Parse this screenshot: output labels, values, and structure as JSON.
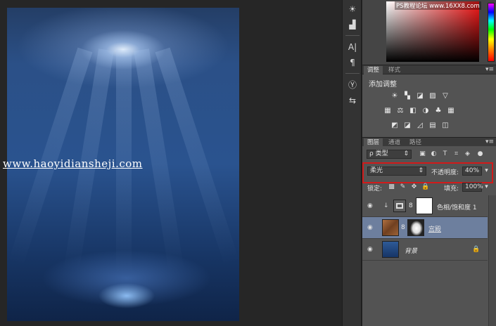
{
  "canvas": {
    "watermark": "www.haoyidiansheji.com"
  },
  "color_panel": {
    "watermark": "PS教程论坛 www.16XX8.com"
  },
  "tool_column": {
    "icons": [
      "brightness-icon",
      "histogram-icon",
      "character-icon",
      "paragraph-icon",
      "brush-preset-icon",
      "tool-preset-icon"
    ],
    "glyphs": [
      "☀",
      "▟",
      "A|",
      "¶",
      "Ⓨ",
      "⇆"
    ]
  },
  "adjust_panel": {
    "tabs": [
      "调整",
      "样式"
    ],
    "title": "添加调整",
    "menu": "▾≡",
    "row1": [
      "☀",
      "▚",
      "◪",
      "▨",
      "▽"
    ],
    "row2": [
      "▦",
      "⚖",
      "◧",
      "◑",
      "♣",
      "▦"
    ],
    "row3": [
      "◩",
      "◪",
      "◿",
      "▤",
      "◫"
    ]
  },
  "layers_panel": {
    "tabs": [
      "图层",
      "通道",
      "路径"
    ],
    "menu": "▾≡",
    "filter_label": "ρ 类型",
    "filter_arrow": "⇕",
    "filter_icons": [
      "▣",
      "◐",
      "T",
      "⌗",
      "◈",
      "●"
    ],
    "blend_mode": "柔光",
    "blend_arrow": "⇕",
    "opacity_label": "不透明度:",
    "opacity_value": "40%",
    "lock_label": "锁定:",
    "lock_icons": [
      "▩",
      "✎",
      "✥",
      "🔒"
    ],
    "fill_label": "填充:",
    "fill_value": "100%",
    "dropdown_arrow": "▾",
    "eye_glyph": "◉",
    "layers": [
      {
        "name": "色相/饱和度 1",
        "type": "adjustment",
        "selected": false
      },
      {
        "name": "宫殿",
        "type": "image",
        "selected": true
      },
      {
        "name": "背景",
        "type": "background",
        "selected": false
      }
    ],
    "lock_glyph": "🔒",
    "clip_glyph": "↓",
    "chain_glyph": "8"
  }
}
